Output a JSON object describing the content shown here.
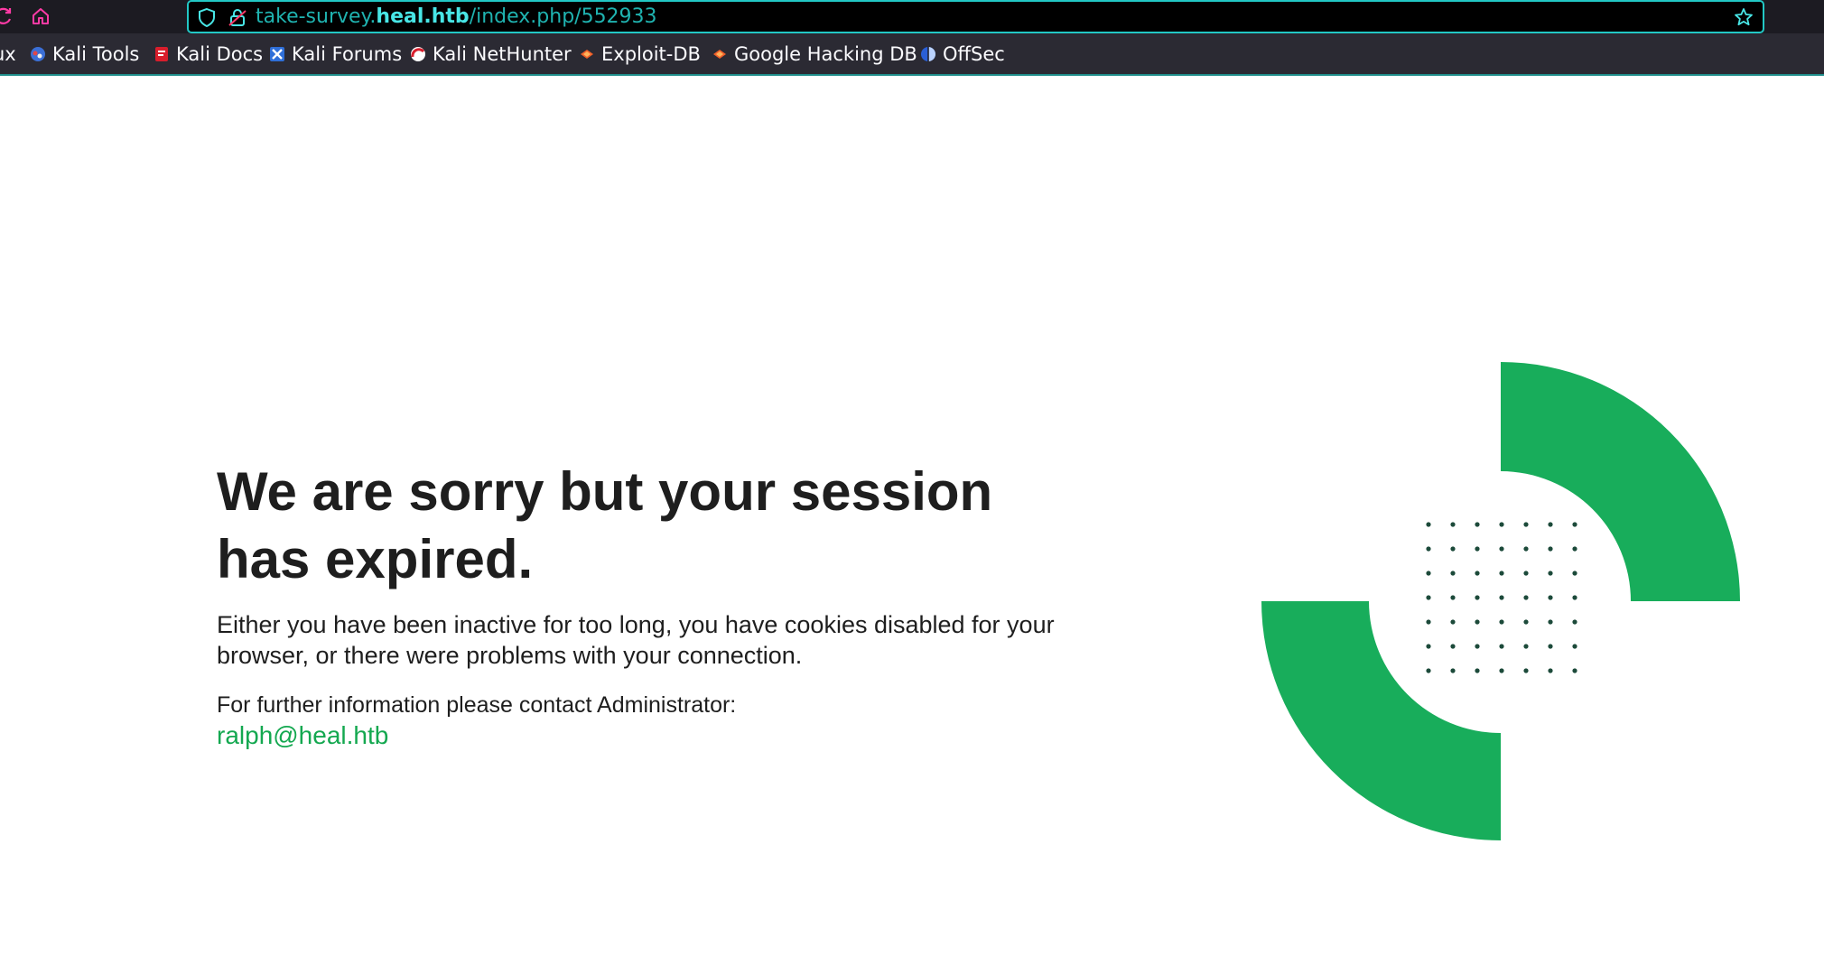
{
  "browser": {
    "url": {
      "prefix": "take-survey.",
      "host": "heal.htb",
      "path": "/index.php/552933"
    },
    "bookmarks": [
      {
        "label": "ux",
        "icon": "kali-linux-icon"
      },
      {
        "label": "Kali Tools",
        "icon": "kali-tools-icon"
      },
      {
        "label": "Kali Docs",
        "icon": "kali-docs-icon"
      },
      {
        "label": "Kali Forums",
        "icon": "kali-forums-icon"
      },
      {
        "label": "Kali NetHunter",
        "icon": "kali-nethunter-icon"
      },
      {
        "label": "Exploit-DB",
        "icon": "exploit-db-icon"
      },
      {
        "label": "Google Hacking DB",
        "icon": "google-hacking-db-icon"
      },
      {
        "label": "OffSec",
        "icon": "offsec-icon"
      }
    ],
    "colors": {
      "accent": "#22c8c5",
      "nav_icon": "#ff3aa5"
    }
  },
  "page": {
    "headline": "We are sorry but your session has expired.",
    "message": "Either you have been inactive for too long, you have cookies disabled for your browser, or there were problems with your connection.",
    "contact_label": "For further information please contact Administrator:",
    "admin_email": "ralph@heal.htb",
    "colors": {
      "brand_green": "#18ad5b",
      "text": "#1e1e1e",
      "dot": "#1c4a3a"
    }
  }
}
